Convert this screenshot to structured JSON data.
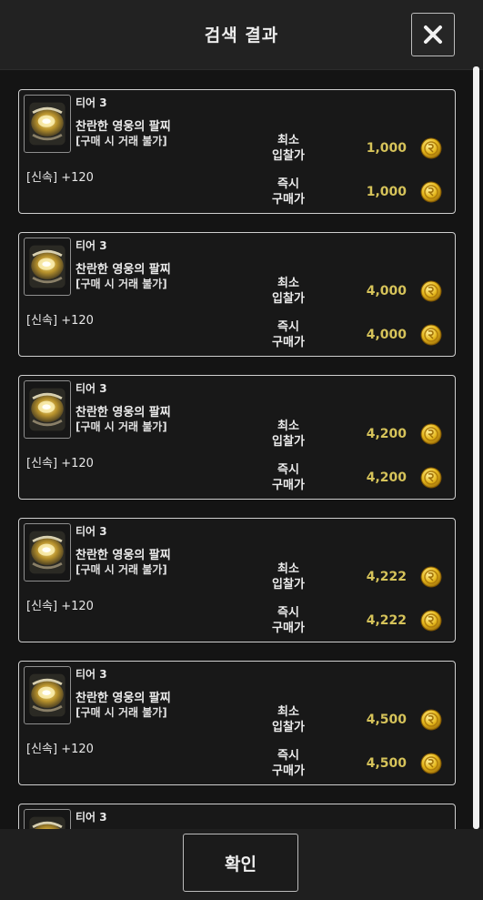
{
  "header": {
    "title": "검색 결과",
    "close_icon": "close-icon"
  },
  "items": [
    {
      "tier": "티어 3",
      "name": "찬란한 영웅의 팔찌",
      "note": "[구매 시 거래 불가]",
      "stat": "[신속] +120",
      "min_bid_label": "최소\n입찰가",
      "min_bid": "1,000",
      "buy_now_label": "즉시\n구매가",
      "buy_now": "1,000"
    },
    {
      "tier": "티어 3",
      "name": "찬란한 영웅의 팔찌",
      "note": "[구매 시 거래 불가]",
      "stat": "[신속] +120",
      "min_bid_label": "최소\n입찰가",
      "min_bid": "4,000",
      "buy_now_label": "즉시\n구매가",
      "buy_now": "4,000"
    },
    {
      "tier": "티어 3",
      "name": "찬란한 영웅의 팔찌",
      "note": "[구매 시 거래 불가]",
      "stat": "[신속] +120",
      "min_bid_label": "최소\n입찰가",
      "min_bid": "4,200",
      "buy_now_label": "즉시\n구매가",
      "buy_now": "4,200"
    },
    {
      "tier": "티어 3",
      "name": "찬란한 영웅의 팔찌",
      "note": "[구매 시 거래 불가]",
      "stat": "[신속] +120",
      "min_bid_label": "최소\n입찰가",
      "min_bid": "4,222",
      "buy_now_label": "즉시\n구매가",
      "buy_now": "4,222"
    },
    {
      "tier": "티어 3",
      "name": "찬란한 영웅의 팔찌",
      "note": "[구매 시 거래 불가]",
      "stat": "[신속] +120",
      "min_bid_label": "최소\n입찰가",
      "min_bid": "4,500",
      "buy_now_label": "즉시\n구매가",
      "buy_now": "4,500"
    },
    {
      "tier": "티어 3",
      "name": "",
      "note": "",
      "stat": "",
      "min_bid_label": "",
      "min_bid": "",
      "buy_now_label": "",
      "buy_now": ""
    }
  ],
  "footer": {
    "confirm_label": "확인"
  },
  "colors": {
    "price": "#d6c35a",
    "coin": "#e6b81c"
  }
}
